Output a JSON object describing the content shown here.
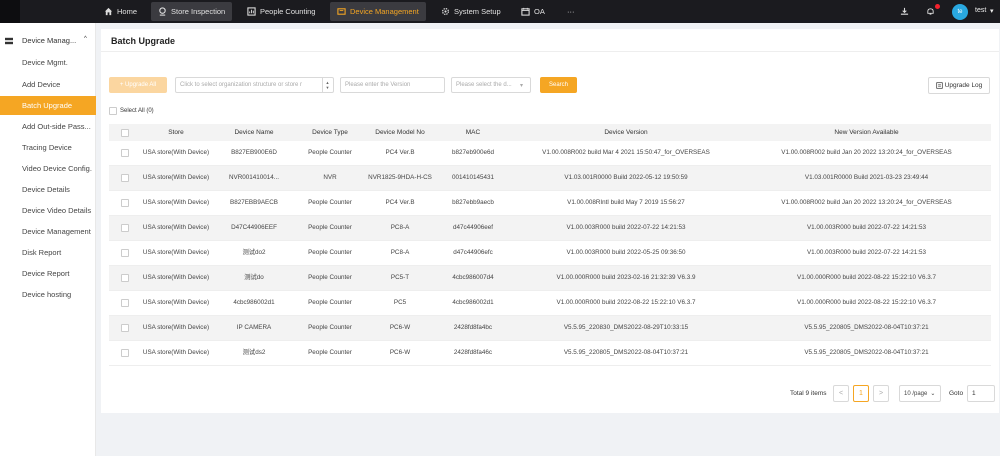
{
  "nav": {
    "items": [
      {
        "label": "Home",
        "icon": "home-icon"
      },
      {
        "label": "Store Inspection",
        "icon": "store-inspection-icon"
      },
      {
        "label": "People Counting",
        "icon": "people-counting-icon"
      },
      {
        "label": "Device Management",
        "icon": "device-management-icon"
      },
      {
        "label": "System Setup",
        "icon": "gear-icon"
      },
      {
        "label": "OA",
        "icon": "calendar-icon"
      },
      {
        "label": "···",
        "icon": "more-icon"
      }
    ],
    "user": {
      "avatar": "te",
      "name": "test"
    }
  },
  "sidebar": {
    "group_label": "Device Manag...",
    "items": [
      "Device Mgmt.",
      "Add Device",
      "Batch Upgrade",
      "Add Out-side Pass...",
      "Tracing Device",
      "Video Device Config.",
      "Device Details",
      "Device Video Details",
      "Device Management",
      "Disk Report",
      "Device Report",
      "Device hosting"
    ],
    "active_index": 2
  },
  "page": {
    "title": "Batch Upgrade",
    "upgrade_all": "+ Upgrade All",
    "org_placeholder": "Click to select organization structure or store r",
    "version_placeholder": "Please enter the Version",
    "model_placeholder": "Please select the d...",
    "search_label": "Search",
    "log_label": "Upgrade Log",
    "select_all": "Select All (0)"
  },
  "table": {
    "columns": [
      "Store",
      "Device Name",
      "Device Type",
      "Device Model No",
      "MAC",
      "Device Version",
      "New Version Available"
    ],
    "rows": [
      [
        "USA store(With Device)",
        "B827EB900E6D",
        "People Counter",
        "PC4 Ver.B",
        "b827eb900e6d",
        "V1.00.008R002 build Mar 4 2021 15:50:47_for_OVERSEAS",
        "V1.00.008R002 build Jan 20 2022 13:20:24_for_OVERSEAS"
      ],
      [
        "USA store(With Device)",
        "NVR001410014...",
        "NVR",
        "NVR1825-9HDA-H-CS",
        "001410145431",
        "V1.03.001R0000 Build 2022-05-12 19:50:59",
        "V1.03.001R0000 Build 2021-03-23 23:49:44"
      ],
      [
        "USA store(With Device)",
        "B827EBB9AECB",
        "People Counter",
        "PC4 Ver.B",
        "b827ebb9aecb",
        "V1.00.008RIntl build May 7 2019 15:56:27",
        "V1.00.008R002 build Jan 20 2022 13:20:24_for_OVERSEAS"
      ],
      [
        "USA store(With Device)",
        "D47C44906EEF",
        "People Counter",
        "PC8-A",
        "d47c44906eef",
        "V1.00.003R000 build 2022-07-22 14:21:53",
        "V1.00.003R000 build 2022-07-22 14:21:53"
      ],
      [
        "USA store(With Device)",
        "测试do2",
        "People Counter",
        "PC8-A",
        "d47c44906efc",
        "V1.00.003R000 build 2022-05-25 09:36:50",
        "V1.00.003R000 build 2022-07-22 14:21:53"
      ],
      [
        "USA store(With Device)",
        "测试do",
        "People Counter",
        "PC5-T",
        "4cbc986007d4",
        "V1.00.000R000 build 2023-02-16 21:32:39 V6.3.9",
        "V1.00.000R000 build 2022-08-22 15:22:10 V6.3.7"
      ],
      [
        "USA store(With Device)",
        "4cbc986002d1",
        "People Counter",
        "PC5",
        "4cbc986002d1",
        "V1.00.000R000 build 2022-08-22 15:22:10 V6.3.7",
        "V1.00.000R000 build 2022-08-22 15:22:10 V6.3.7"
      ],
      [
        "USA store(With Device)",
        "IP CAMERA",
        "People Counter",
        "PC6-W",
        "2428fd8fa4bc",
        "V5.5.95_220830_DMS2022-08-29T10:33:15",
        "V5.5.95_220805_DMS2022-08-04T10:37:21"
      ],
      [
        "USA store(With Device)",
        "测试ds2",
        "People Counter",
        "PC6-W",
        "2428fd8fa46c",
        "V5.5.95_220805_DMS2022-08-04T10:37:21",
        "V5.5.95_220805_DMS2022-08-04T10:37:21"
      ]
    ]
  },
  "pagination": {
    "total": "Total 9 items",
    "prev": "<",
    "current": "1",
    "next": ">",
    "page_size": "10 /page",
    "goto_label": "Goto",
    "goto_value": "1"
  }
}
